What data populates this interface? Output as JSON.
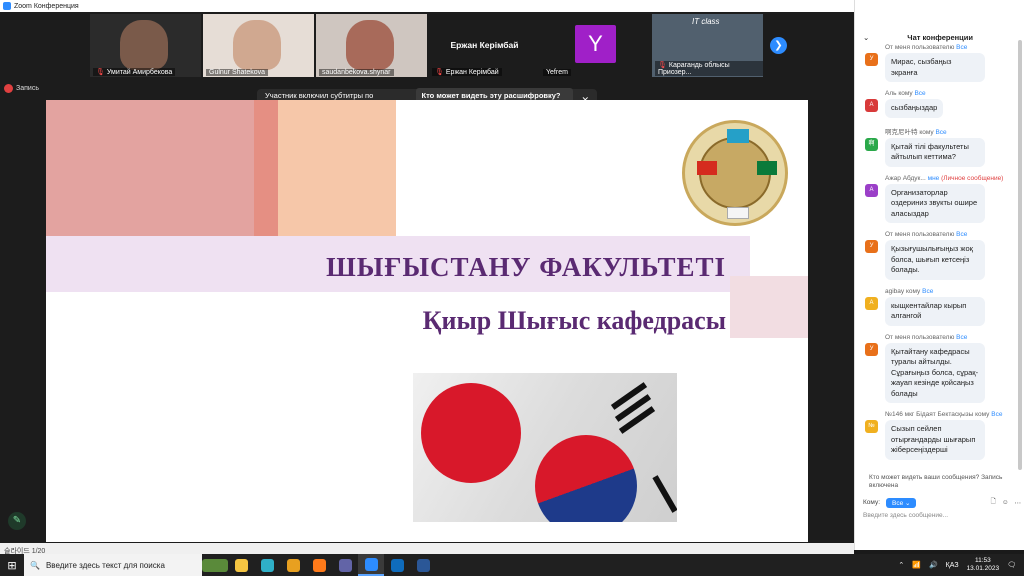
{
  "window": {
    "title": "Zoom Конференция"
  },
  "participants": [
    {
      "name": "Умитай Амирбекова",
      "muted": true,
      "color": "#6b5a50"
    },
    {
      "name": "Gulnur Shatekova",
      "muted": false,
      "color": "#d9c3b8"
    },
    {
      "name": "saudanbekova.shynar",
      "muted": false,
      "color": "#b96a63"
    },
    {
      "name": "Ержан Керімбай",
      "display": "Ержан Керімбай",
      "muted": true,
      "color": "#1c1c1c"
    },
    {
      "name": "Yefrem",
      "avatar_letter": "Y",
      "muted": false,
      "color": "#1c1c1c"
    },
    {
      "name": "Карагандь облысы Приозер...",
      "overlay_text": "IT class",
      "muted": true,
      "color": "#4a5a6a"
    }
  ],
  "recording_label": "Запись",
  "subtitle_notice": {
    "text": "Участник включил субтитры по требованию",
    "button": "Кто может видеть эту расшифровку? За..."
  },
  "slide": {
    "title": "ШЫҒЫСТАНУ ФАКУЛЬТЕТІ",
    "subtitle": "Қиыр Шығыс кафедрасы",
    "counter": "슬라이드 1/20"
  },
  "chat": {
    "title": "Чат конференции",
    "messages": [
      {
        "from": "От меня пользователю",
        "to": "Все",
        "avatar": "У",
        "avatar_color": "#e8701a",
        "text": "Мирас, сызбаңыз экранға"
      },
      {
        "from": "Аль",
        "to": "Все",
        "kw": "кому",
        "avatar": "А",
        "avatar_color": "#d83a3a",
        "text": "сызбаңыздар"
      },
      {
        "from": "啊克尼叶特",
        "to": "Все",
        "kw": "кому",
        "avatar": "啊",
        "avatar_color": "#2aa84a",
        "text": "Қытай тілі факультеты айтылып кеттима?"
      },
      {
        "from": "Ажар Абдук...",
        "to": "мне",
        "priv": "(Личное сообщение)",
        "avatar": "А",
        "avatar_color": "#9b3fc8",
        "text": "Организаторлар оздериниз звукты ошире аласыздар"
      },
      {
        "from": "От меня пользователю",
        "to": "Все",
        "avatar": "У",
        "avatar_color": "#e8701a",
        "text": "Қызығушылығыңыз жоқ болса, шығып кетсеңіз болады."
      },
      {
        "from": "agibay",
        "to": "Все",
        "kw": "кому",
        "avatar": "А",
        "avatar_color": "#f0b020",
        "text": "кыщкентайлар кырып алгангой"
      },
      {
        "from": "От меня пользователю",
        "to": "Все",
        "avatar": "У",
        "avatar_color": "#e8701a",
        "text": "Қытайтану кафедрасы туралы айтылды. Сұрағыңыз болса, сұрақ-жауап кезінде қойсаңыз болады"
      },
      {
        "from": "№146 мкг Бідаят Бектасқызы",
        "to": "Все",
        "kw": "кому",
        "avatar": "№",
        "avatar_color": "#f0b020",
        "text": "Сызып сейлеп отырғандарды шығарып жіберсеңіздерші"
      }
    ],
    "who_can_see": "Кто может видеть ваши сообщения? Запись включена",
    "to_label": "Кому:",
    "to_value": "Все",
    "input_placeholder": "Введите здесь сообщение..."
  },
  "taskbar": {
    "search_placeholder": "Введите здесь текст для поиска",
    "lang": "ҚАЗ",
    "time": "11:53",
    "date": "13.01.2023",
    "apps": [
      {
        "name": "file-explorer-icon",
        "color": "#f5c542"
      },
      {
        "name": "edge-icon",
        "color": "#2fb0c8"
      },
      {
        "name": "chrome-icon",
        "color": "#e8a020"
      },
      {
        "name": "firefox-icon",
        "color": "#ff7a1a"
      },
      {
        "name": "teams-icon",
        "color": "#6264a7"
      },
      {
        "name": "zoom-icon",
        "color": "#2d8cff"
      },
      {
        "name": "outlook-icon",
        "color": "#0f6cbd"
      },
      {
        "name": "word-icon",
        "color": "#2b5797"
      }
    ]
  }
}
